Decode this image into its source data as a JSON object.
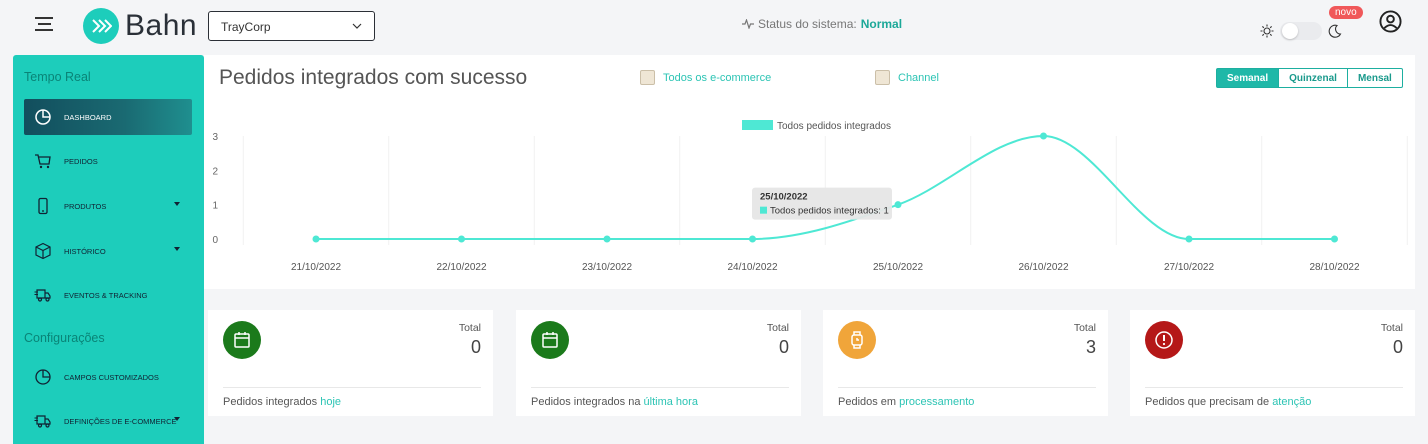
{
  "header": {
    "logo_text": "Bahn",
    "company_selected": "TrayCorp",
    "status_label": "Status do sistema:",
    "status_value": "Normal",
    "badge_new": "novo",
    "icons": {
      "menu": "hamburger-icon",
      "status": "pulse-icon",
      "sun": "sun-icon",
      "moon": "moon-icon",
      "user": "user-circle-icon"
    }
  },
  "sidebar": {
    "section_realtime": "Tempo Real",
    "section_config": "Configurações",
    "items": [
      {
        "label": "DASHBOARD",
        "icon": "pie-chart-icon",
        "active": true
      },
      {
        "label": "PEDIDOS",
        "icon": "cart-icon"
      },
      {
        "label": "PRODUTOS",
        "icon": "mobile-icon",
        "has_sub": true
      },
      {
        "label": "HISTÓRICO",
        "icon": "box-icon",
        "has_sub": true
      },
      {
        "label": "EVENTOS & TRACKING",
        "icon": "truck-icon"
      },
      {
        "label": "CAMPOS CUSTOMIZADOS",
        "icon": "pie-chart-icon"
      },
      {
        "label": "DEFINIÇÕES DE E-COMMERCE",
        "icon": "truck-icon",
        "has_sub": true
      }
    ]
  },
  "main": {
    "chart_title": "Pedidos integrados com sucesso",
    "filters": [
      "Todos os e-commerce",
      "Channel"
    ],
    "periods": [
      "Semanal",
      "Quinzenal",
      "Mensal"
    ],
    "active_period": "Semanal",
    "tooltip": {
      "date": "25/10/2022",
      "text": "Todos pedidos integrados: 1"
    }
  },
  "chart_data": {
    "type": "line",
    "categories": [
      "21/10/2022",
      "22/10/2022",
      "23/10/2022",
      "24/10/2022",
      "25/10/2022",
      "26/10/2022",
      "27/10/2022",
      "28/10/2022"
    ],
    "series": [
      {
        "name": "Todos pedidos integrados",
        "values": [
          0,
          0,
          0,
          0,
          1,
          3,
          0,
          0
        ],
        "color": "#4ee8d4"
      }
    ],
    "yticks": [
      0,
      1,
      2,
      3
    ],
    "ylim": [
      0,
      3
    ],
    "legend": "top-center",
    "grid": true
  },
  "stats": [
    {
      "total_label": "Total",
      "value": "0",
      "foot_prefix": "Pedidos integrados ",
      "foot_highlight": "hoje",
      "color": "#1b7a1b",
      "icon": "calendar-icon"
    },
    {
      "total_label": "Total",
      "value": "0",
      "foot_prefix": "Pedidos integrados na ",
      "foot_highlight": "última hora",
      "color": "#1b7a1b",
      "icon": "calendar-icon"
    },
    {
      "total_label": "Total",
      "value": "3",
      "foot_prefix": "Pedidos em ",
      "foot_highlight": "processamento",
      "color": "#f0a53a",
      "icon": "watch-icon"
    },
    {
      "total_label": "Total",
      "value": "0",
      "foot_prefix": "Pedidos que precisam de ",
      "foot_highlight": "atenção",
      "color": "#b51818",
      "icon": "alert-icon"
    }
  ]
}
